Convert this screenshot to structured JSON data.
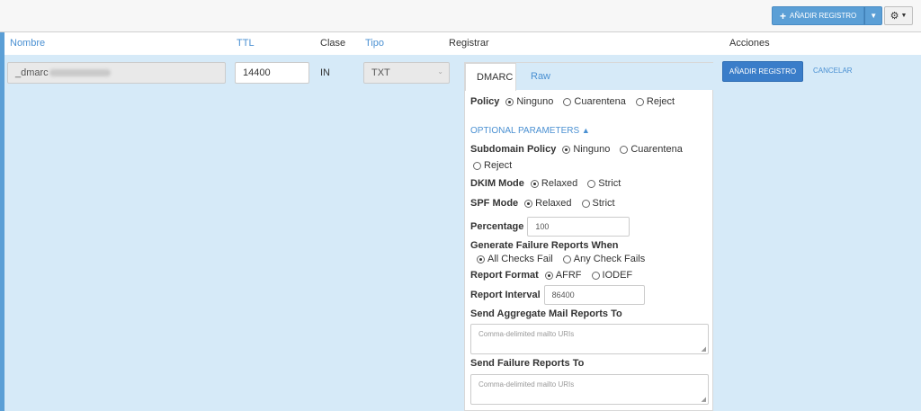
{
  "toolbar": {
    "add_label": "AÑADIR REGISTRO",
    "add_icon": "plus-icon",
    "caret_icon": "caret-down-icon",
    "gear_icon": "gear-icon"
  },
  "columns": {
    "name": "Nombre",
    "ttl": "TTL",
    "class": "Clase",
    "type": "Tipo",
    "record": "Registrar",
    "actions": "Acciones"
  },
  "row": {
    "name_value": "_dmarc",
    "ttl_value": "14400",
    "class_value": "IN",
    "type_value": "TXT",
    "save_label": "AÑADIR REGISTRO",
    "cancel_label": "CANCELAR"
  },
  "tabs": {
    "dmarc": "DMARC",
    "raw": "Raw"
  },
  "form": {
    "policy": {
      "label": "Policy",
      "options": [
        "Ninguno",
        "Cuarentena",
        "Reject"
      ],
      "selected": "Ninguno"
    },
    "optional_params": "OPTIONAL PARAMETERS",
    "subdomain_policy": {
      "label": "Subdomain Policy",
      "options": [
        "Ninguno",
        "Cuarentena",
        "Reject"
      ],
      "selected": "Ninguno"
    },
    "dkim_mode": {
      "label": "DKIM Mode",
      "options": [
        "Relaxed",
        "Strict"
      ],
      "selected": "Relaxed"
    },
    "spf_mode": {
      "label": "SPF Mode",
      "options": [
        "Relaxed",
        "Strict"
      ],
      "selected": "Relaxed"
    },
    "percentage": {
      "label": "Percentage",
      "value": "100"
    },
    "failure_when": {
      "label": "Generate Failure Reports When",
      "options": [
        "All Checks Fail",
        "Any Check Fails"
      ],
      "selected": "All Checks Fail"
    },
    "report_format": {
      "label": "Report Format",
      "options": [
        "AFRF",
        "IODEF"
      ],
      "selected": "AFRF"
    },
    "report_interval": {
      "label": "Report Interval",
      "value": "86400"
    },
    "aggregate_to": {
      "label": "Send Aggregate Mail Reports To",
      "placeholder": "Comma-delimited mailto URIs"
    },
    "failure_to": {
      "label": "Send Failure Reports To",
      "placeholder": "Comma-delimited mailto URIs"
    }
  }
}
